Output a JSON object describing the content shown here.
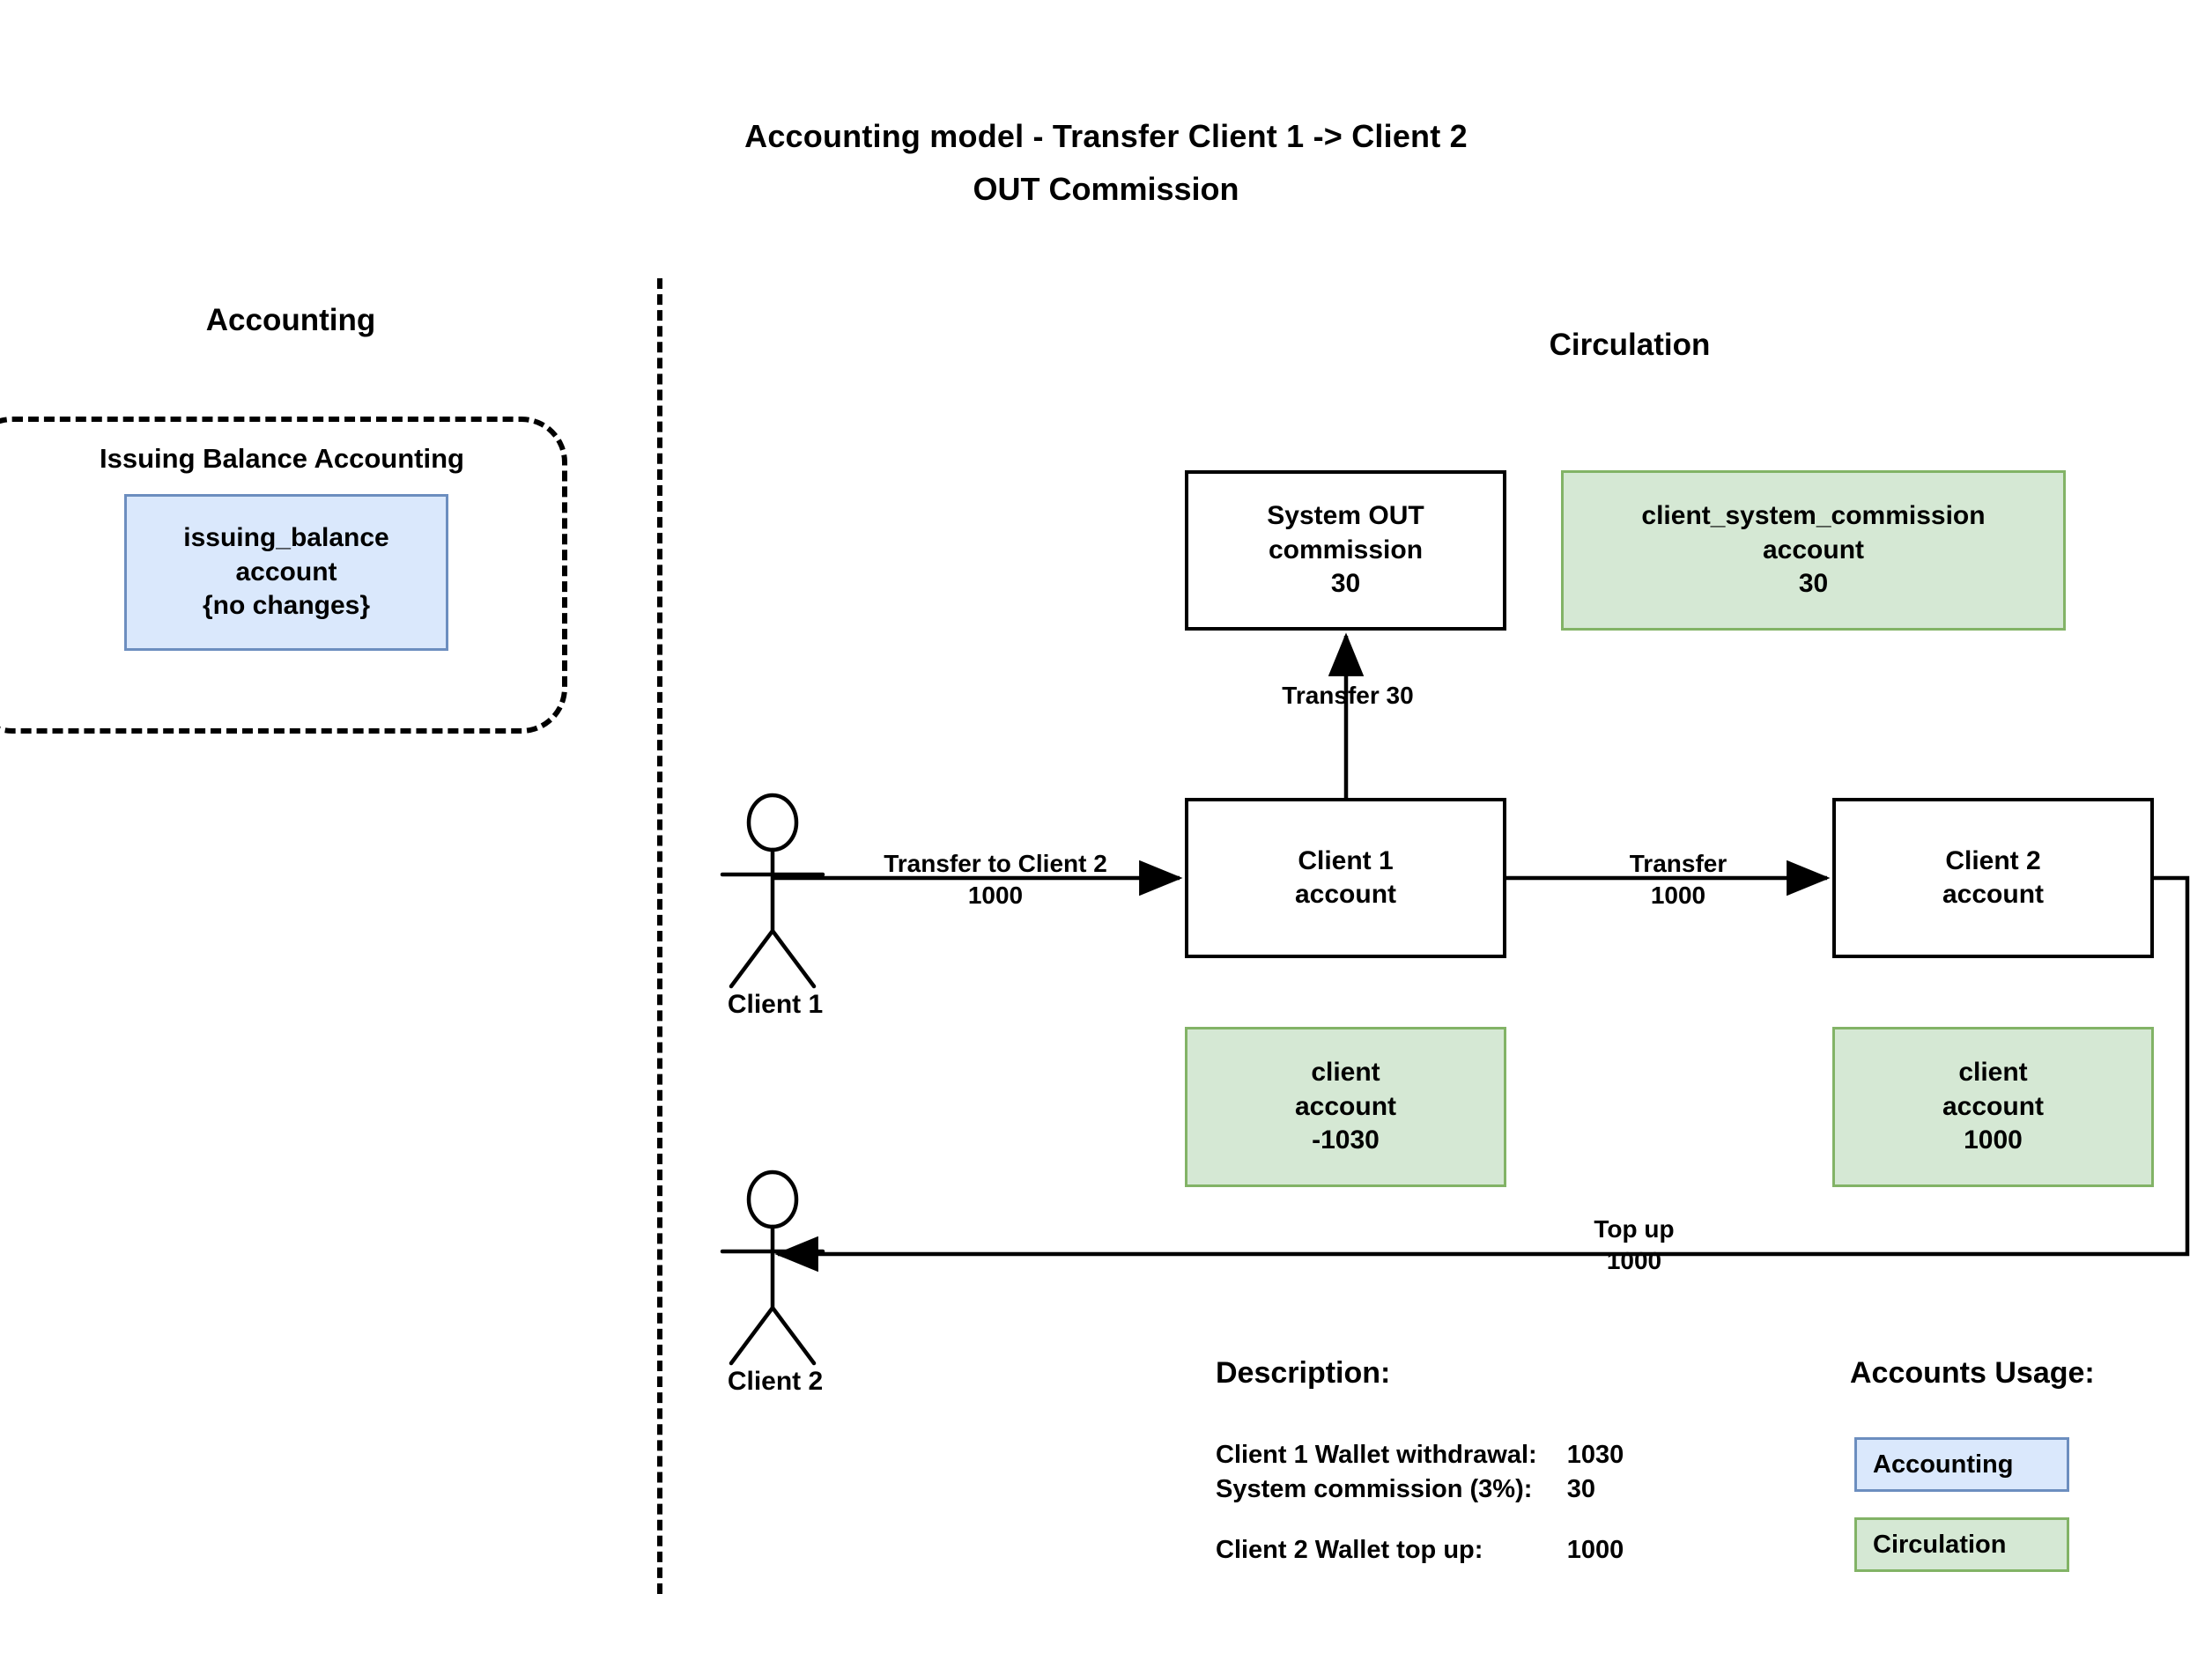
{
  "title": {
    "line1": "Accounting model - Transfer Client 1 -> Client 2",
    "line2": "OUT Commission"
  },
  "columns": {
    "left_heading": "Accounting",
    "right_heading": "Circulation"
  },
  "accounting": {
    "group_label": "Issuing Balance Accounting",
    "issuing_balance_box": "issuing_balance\naccount\n{no changes}"
  },
  "circulation": {
    "system_out_commission_box": "System OUT\ncommission\n30",
    "client_system_commission_box": "client_system_commission\naccount\n30",
    "client1_account_box": "Client 1\naccount",
    "client2_account_box": "Client 2\naccount",
    "client1_green_box": "client\naccount\n-1030",
    "client2_green_box": "client\naccount\n1000"
  },
  "edges": {
    "transfer_commission": "Transfer 30",
    "transfer_to_client2": "Transfer to Client 2\n1000",
    "transfer_1000": "Transfer\n1000",
    "top_up": "Top up\n1000"
  },
  "actors": {
    "client1": "Client 1",
    "client2": "Client 2"
  },
  "description": {
    "heading": "Description:",
    "rows": [
      {
        "label": "Client 1 Wallet withdrawal:",
        "value": "1030"
      },
      {
        "label": "System commission (3%):",
        "value": "30"
      },
      {
        "label": "Client 2 Wallet top up:",
        "value": "1000"
      }
    ]
  },
  "accounts_usage": {
    "heading": "Accounts Usage:",
    "legend": [
      {
        "label": "Accounting",
        "fill": "#dae8fc",
        "stroke": "#6c8ebf"
      },
      {
        "label": "Circulation",
        "fill": "#d5e8d4",
        "stroke": "#82b366"
      }
    ]
  },
  "colors": {
    "accounting_fill": "#dae8fc",
    "accounting_stroke": "#6c8ebf",
    "circulation_fill": "#d5e8d4",
    "circulation_stroke": "#82b366",
    "line": "#000000",
    "background": "#ffffff"
  }
}
